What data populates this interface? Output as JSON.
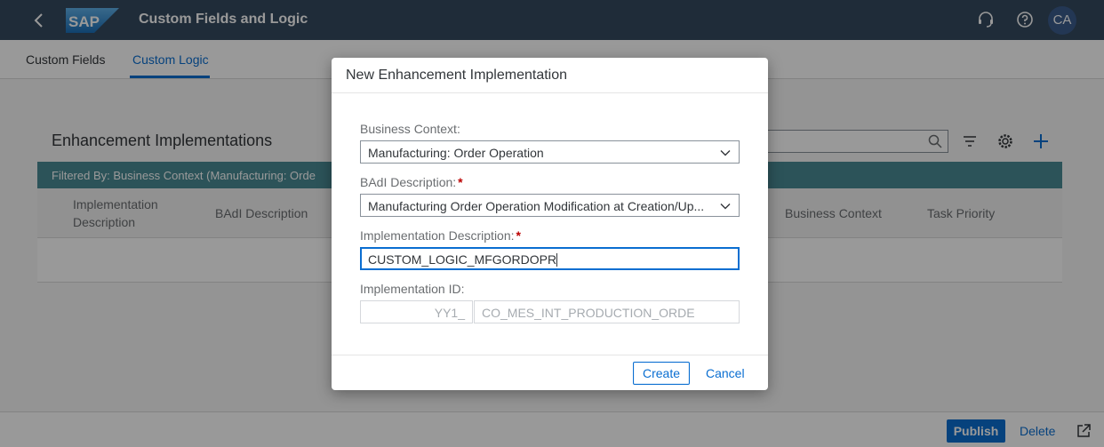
{
  "shell": {
    "title": "Custom Fields and Logic",
    "logo_text": "SAP",
    "avatar_initials": "CA",
    "icons": [
      "back-icon",
      "support-icon",
      "help-icon"
    ]
  },
  "tabs": [
    {
      "label": "Custom Fields",
      "active": false
    },
    {
      "label": "Custom Logic",
      "active": true
    }
  ],
  "page": {
    "section_title": "Enhancement Implementations",
    "filter_text": "Filtered By: Business Context (Manufacturing: Orde",
    "columns": [
      "Implementation Description",
      "BAdI Description",
      "Business Context",
      "Task Priority"
    ],
    "footer": {
      "publish_label": "Publish",
      "delete_label": "Delete"
    }
  },
  "dialog": {
    "title": "New Enhancement Implementation",
    "business_context_label": "Business Context:",
    "business_context_value": "Manufacturing: Order Operation",
    "badi_label": "BAdI Description:",
    "badi_value": "Manufacturing Order Operation Modification at Creation/Up...",
    "impl_desc_label": "Implementation Description:",
    "impl_desc_value": "CUSTOM_LOGIC_MFGORDOPR",
    "impl_id_label": "Implementation ID:",
    "impl_id_prefix": "YY1_",
    "impl_id_value": "CO_MES_INT_PRODUCTION_ORDE",
    "create_label": "Create",
    "cancel_label": "Cancel"
  },
  "colors": {
    "shell": "#354a5f",
    "accent": "#0a6ed1",
    "filter_bar": "#4a8a94",
    "required": "#bb0000"
  }
}
